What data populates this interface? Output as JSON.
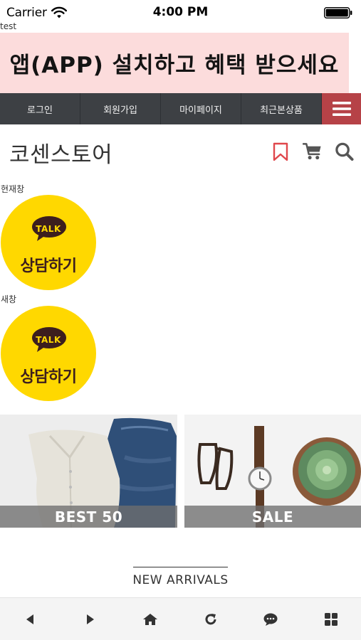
{
  "status_bar": {
    "carrier": "Carrier",
    "time": "4:00 PM"
  },
  "test_label": "test",
  "app_banner": {
    "text": "앱(APP) 설치하고 혜택 받으세요"
  },
  "top_nav": {
    "items": [
      {
        "label": "로그인"
      },
      {
        "label": "회원가입"
      },
      {
        "label": "마이페이지"
      },
      {
        "label": "최근본상품"
      }
    ],
    "menu_icon": "hamburger-icon"
  },
  "header": {
    "store_name": "코센스토어",
    "icons": [
      "bookmark-icon",
      "cart-icon",
      "search-icon"
    ]
  },
  "talk_widgets": [
    {
      "label": "현재창",
      "badge": "TALK",
      "caption": "상담하기"
    },
    {
      "label": "새창",
      "badge": "TALK",
      "caption": "상담하기"
    }
  ],
  "category_banners": [
    {
      "caption": "BEST 50"
    },
    {
      "caption": "SALE"
    }
  ],
  "section": {
    "title": "NEW ARRIVALS"
  },
  "bottom_toolbar": {
    "icons": [
      "back-icon",
      "forward-icon",
      "home-icon",
      "refresh-icon",
      "chat-icon",
      "grid-icon"
    ]
  },
  "colors": {
    "banner_bg": "#fcdcdc",
    "nav_bg": "#3d4044",
    "menu_bg": "#b64247",
    "accent": "#e0474c",
    "talk_yellow": "#ffd800"
  }
}
